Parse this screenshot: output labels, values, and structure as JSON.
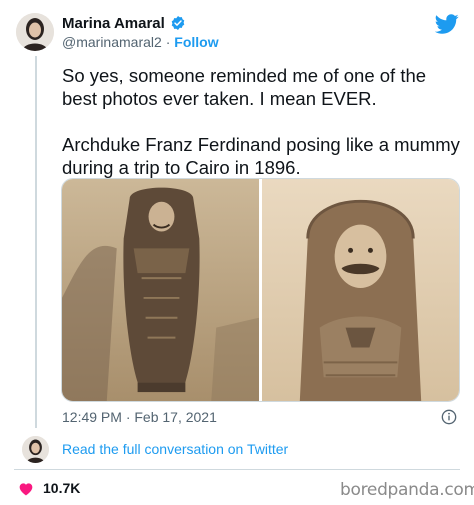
{
  "author": {
    "name": "Marina Amaral",
    "handle": "@marinamaral2",
    "separator": "·",
    "follow_label": "Follow",
    "verified": true
  },
  "icons": {
    "brand": "twitter-bird-icon",
    "verified": "verified-badge-icon",
    "info": "info-icon",
    "like": "heart-icon"
  },
  "tweet": {
    "paragraphs": [
      "So yes, someone reminded me of one of the best photos ever taken. I mean EVER.",
      "Archduke Franz Ferdinand posing like a mummy during a trip to Cairo in 1896."
    ],
    "timestamp": "12:49 PM · Feb 17, 2021"
  },
  "conversation": {
    "link_label": "Read the full conversation on Twitter"
  },
  "engagement": {
    "likes": "10.7K"
  },
  "watermark": {
    "text": "boredpanda.com"
  },
  "colors": {
    "accent": "#1d9bf0",
    "like": "#f91880",
    "text": "#0f1419",
    "muted": "#536471",
    "photo_sepia": "#b9a07e"
  }
}
